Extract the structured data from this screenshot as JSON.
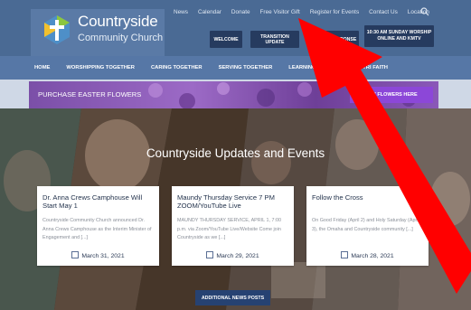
{
  "logo": {
    "title": "Countryside",
    "subtitle": "Community Church"
  },
  "top_nav": [
    "News",
    "Calendar",
    "Donate",
    "Free Visitor Gift",
    "Register for Events",
    "Contact Us",
    "Location"
  ],
  "pills": {
    "welcome": "WELCOME",
    "transition": "TRANSITION UPDATE",
    "covid": "COVID RESPONSE",
    "worship_line1": "10:30 AM SUNDAY WORSHIP",
    "worship_line2": "ONLINE AND KMTV"
  },
  "main_nav": [
    "HOME",
    "WORSHIPPING TOGETHER",
    "CARING TOGETHER",
    "SERVING TOGETHER",
    "LEARNING TOGETHER",
    "TRI FAITH"
  ],
  "easter": {
    "label": "PURCHASE EASTER FLOWERS",
    "button": "BUY FLOWERS HERE"
  },
  "hero": {
    "title": "Countryside Updates and Events"
  },
  "cards": [
    {
      "title": "Dr. Anna Crews Camphouse Will Start May 1",
      "excerpt": "Countryside Community Church announced Dr. Anna Crews Camphouse as the Interim Minister of Engagement and [...]",
      "date": "March 31, 2021"
    },
    {
      "title": "Maundy Thursday Service 7 PM ZOOM/YouTube Live",
      "excerpt": "MAUNDY THURSDAY SERVICE, APRIL 1, 7:00 p.m. via Zoom/YouTube Live/Website Come join Countryside as we [...]",
      "date": "March 29, 2021"
    },
    {
      "title": "Follow the Cross",
      "excerpt": "On Good Friday (April 2) and Holy Saturday (April 3), the Omaha and Countryside community [...]",
      "date": "March 28, 2021"
    }
  ],
  "news_button": "ADDITIONAL NEWS POSTS",
  "colors": {
    "header": "#4a6a94",
    "main_nav": "#5677a6",
    "dark_button": "#263b5f",
    "purple_button": "#8c47d8",
    "annotation_arrow": "#ff0000"
  }
}
